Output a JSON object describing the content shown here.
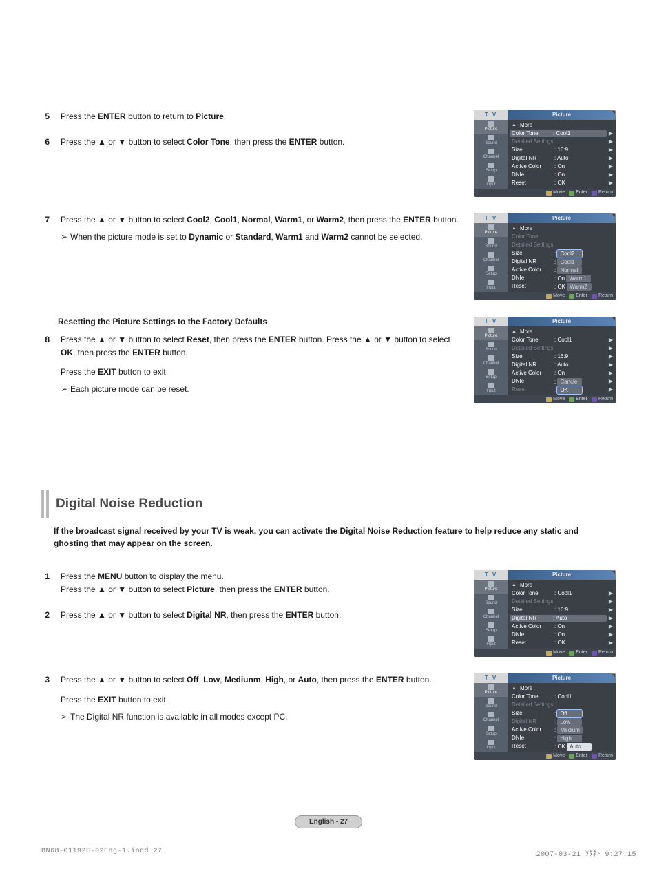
{
  "steps_a": {
    "5": [
      "Press the ",
      "ENTER",
      " button to return to ",
      "Picture",
      "."
    ],
    "6": [
      "Press the ▲ or ▼ button to select ",
      "Color Tone",
      ", then press the ",
      "ENTER",
      " button."
    ],
    "7": {
      "main": [
        "Press the ▲ or ▼ button to select ",
        "Cool2",
        ", ",
        "Cool1",
        ", ",
        "Normal",
        ", ",
        "Warm1",
        ", or ",
        "Warm2",
        ", then press the ",
        "ENTER",
        " button."
      ],
      "sub": [
        "When the picture mode is set to ",
        "Dynamic",
        " or ",
        "Standard",
        ", ",
        "Warm1",
        " and ",
        "Warm2",
        " cannot be selected."
      ]
    },
    "heading": "Resetting the Picture Settings to the Factory Defaults",
    "8": {
      "main1": [
        "Press the ▲ or ▼ button to select ",
        "Reset",
        ", then press the ",
        "ENTER",
        " button. Press the ▲ or ▼ button to select ",
        "OK",
        ", then press the ",
        "ENTER",
        " button."
      ],
      "main2": [
        "Press the ",
        "EXIT",
        " button to exit."
      ],
      "sub": "Each picture mode can be reset."
    }
  },
  "section2": {
    "title": "Digital Noise Reduction",
    "intro": "If the broadcast signal received by your TV is weak, you can activate the Digital Noise Reduction feature to help reduce any static and ghosting that may appear on the screen.",
    "steps": {
      "1": {
        "l1": [
          "Press the ",
          "MENU",
          " button to display the menu."
        ],
        "l2": [
          "Press the ▲ or ▼ button to select ",
          "Picture",
          ", then press the ",
          "ENTER",
          " button."
        ]
      },
      "2": [
        "Press the ▲ or ▼ button to select ",
        "Digital NR",
        ", then press the ",
        "ENTER",
        " button."
      ],
      "3": {
        "main": [
          "Press the ▲ or ▼ button to select ",
          "Off",
          ", ",
          "Low",
          ", ",
          "Mediunm",
          ", ",
          "High",
          ", or ",
          "Auto",
          ", then press the ",
          "ENTER",
          " button."
        ],
        "main2": [
          "Press the ",
          "EXIT",
          " button to exit."
        ],
        "sub": "The Digital NR function is available in all modes except PC."
      }
    }
  },
  "menus": {
    "tv": "T V",
    "title": "Picture",
    "sidebar": [
      "Picture",
      "Sound",
      "Channel",
      "Setup",
      "Input"
    ],
    "footer": {
      "move": "Move",
      "enter": "Enter",
      "return": "Return"
    },
    "m1": {
      "more": "More",
      "rows": [
        {
          "l": "Color Tone",
          "v": ": Cool1",
          "sel": true
        },
        {
          "l": "Detailed Settings",
          "v": "",
          "dim": true
        },
        {
          "l": "Size",
          "v": ": 16:9"
        },
        {
          "l": "Digital NR",
          "v": ": Auto"
        },
        {
          "l": "Active Color",
          "v": ": On"
        },
        {
          "l": "DNIe",
          "v": ": On"
        },
        {
          "l": "Reset",
          "v": ": OK"
        }
      ]
    },
    "m2": {
      "more": "More",
      "dimrows": [
        "Color Tone",
        "Detailed Settings"
      ],
      "opts": [
        "Cool2",
        "Cool1",
        "Normal",
        "Warm1",
        "Warm2"
      ],
      "optsel": 0,
      "optdim": [
        3,
        4
      ],
      "rows": [
        {
          "l": "Size",
          "v": ":"
        },
        {
          "l": "Digital NR",
          "v": ":"
        },
        {
          "l": "Active Color",
          "v": ":"
        },
        {
          "l": "DNIe",
          "v": ": On"
        },
        {
          "l": "Reset",
          "v": ": OK"
        }
      ]
    },
    "m3": {
      "more": "More",
      "rows": [
        {
          "l": "Color Tone",
          "v": ": Cool1"
        },
        {
          "l": "Detailed Settings",
          "v": "",
          "dim": true
        },
        {
          "l": "Size",
          "v": ": 16:9"
        },
        {
          "l": "Digital NR",
          "v": ": Auto"
        },
        {
          "l": "Active Color",
          "v": ": On"
        },
        {
          "l": "DNIe",
          "v": ":",
          "opt": "Cancle"
        },
        {
          "l": "Reset",
          "v": ":",
          "dim": true,
          "opt": "OK",
          "optsel": true
        }
      ]
    },
    "m4": {
      "more": "More",
      "rows": [
        {
          "l": "Color Tone",
          "v": ": Cool1"
        },
        {
          "l": "Detailed Settings",
          "v": "",
          "dim": true
        },
        {
          "l": "Size",
          "v": ": 16:9"
        },
        {
          "l": "Digital NR",
          "v": ": Auto",
          "sel": true
        },
        {
          "l": "Active Color",
          "v": ": On"
        },
        {
          "l": "DNIe",
          "v": ": On"
        },
        {
          "l": "Reset",
          "v": ": OK"
        }
      ]
    },
    "m5": {
      "more": "More",
      "rows": [
        {
          "l": "Color Tone",
          "v": ": Cool1"
        },
        {
          "l": "Detailed Settings",
          "v": "",
          "dim": true
        },
        {
          "l": "Size",
          "v": ":"
        },
        {
          "l": "Digital NR",
          "v": ":",
          "dim": true
        },
        {
          "l": "Active Color",
          "v": ":"
        },
        {
          "l": "DNIe",
          "v": ":"
        },
        {
          "l": "Reset",
          "v": ": OK"
        }
      ],
      "opts": [
        "Off",
        "Low",
        "Medium",
        "High",
        "Auto"
      ],
      "optsel": 0,
      "optwhite": 4
    }
  },
  "page_footer": "English - 27",
  "file_footer": {
    "left": "BN68-01192E-02Eng-1.indd   27",
    "right": "2007-03-21   ｿﾀﾈﾄ 9:27:15"
  }
}
